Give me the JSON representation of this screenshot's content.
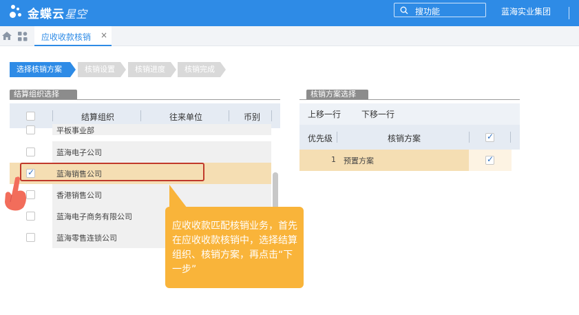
{
  "app": {
    "brand": "金蝶云",
    "product": "星空",
    "search_placeholder": "搜功能",
    "company": "蓝海实业集团"
  },
  "tabs": [
    {
      "label": "应收收款核销",
      "close": "×"
    }
  ],
  "steps": [
    "选择核销方案",
    "核销设置",
    "核销进度",
    "核销完成"
  ],
  "org_section": {
    "title": "结算组织选择",
    "columns": [
      "结算组织",
      "往来单位",
      "币别"
    ],
    "rows": [
      {
        "org": "平板事业部",
        "checked": false
      },
      {
        "org": "蓝海电子公司",
        "checked": false
      },
      {
        "org": "蓝海销售公司",
        "checked": true
      },
      {
        "org": "香港销售公司",
        "checked": false
      },
      {
        "org": "蓝海电子商务有限公司",
        "checked": false
      },
      {
        "org": "蓝海零售连锁公司",
        "checked": false
      }
    ]
  },
  "plan_section": {
    "title": "核销方案选择",
    "move_up": "上移一行",
    "move_down": "下移一行",
    "columns": [
      "优先级",
      "核销方案"
    ],
    "rows": [
      {
        "priority": "1",
        "plan": "预置方案",
        "checked": true
      }
    ]
  },
  "tooltip": {
    "text": "应收收款匹配核销业务，首先在应收收款核销中，选择结算组织、核销方案，再点击“下一步”"
  },
  "colors": {
    "topbar": "#2e8be6",
    "selected_row": "#f5deb3",
    "tooltip": "#f9b43a",
    "highlight": "#c0392b"
  }
}
